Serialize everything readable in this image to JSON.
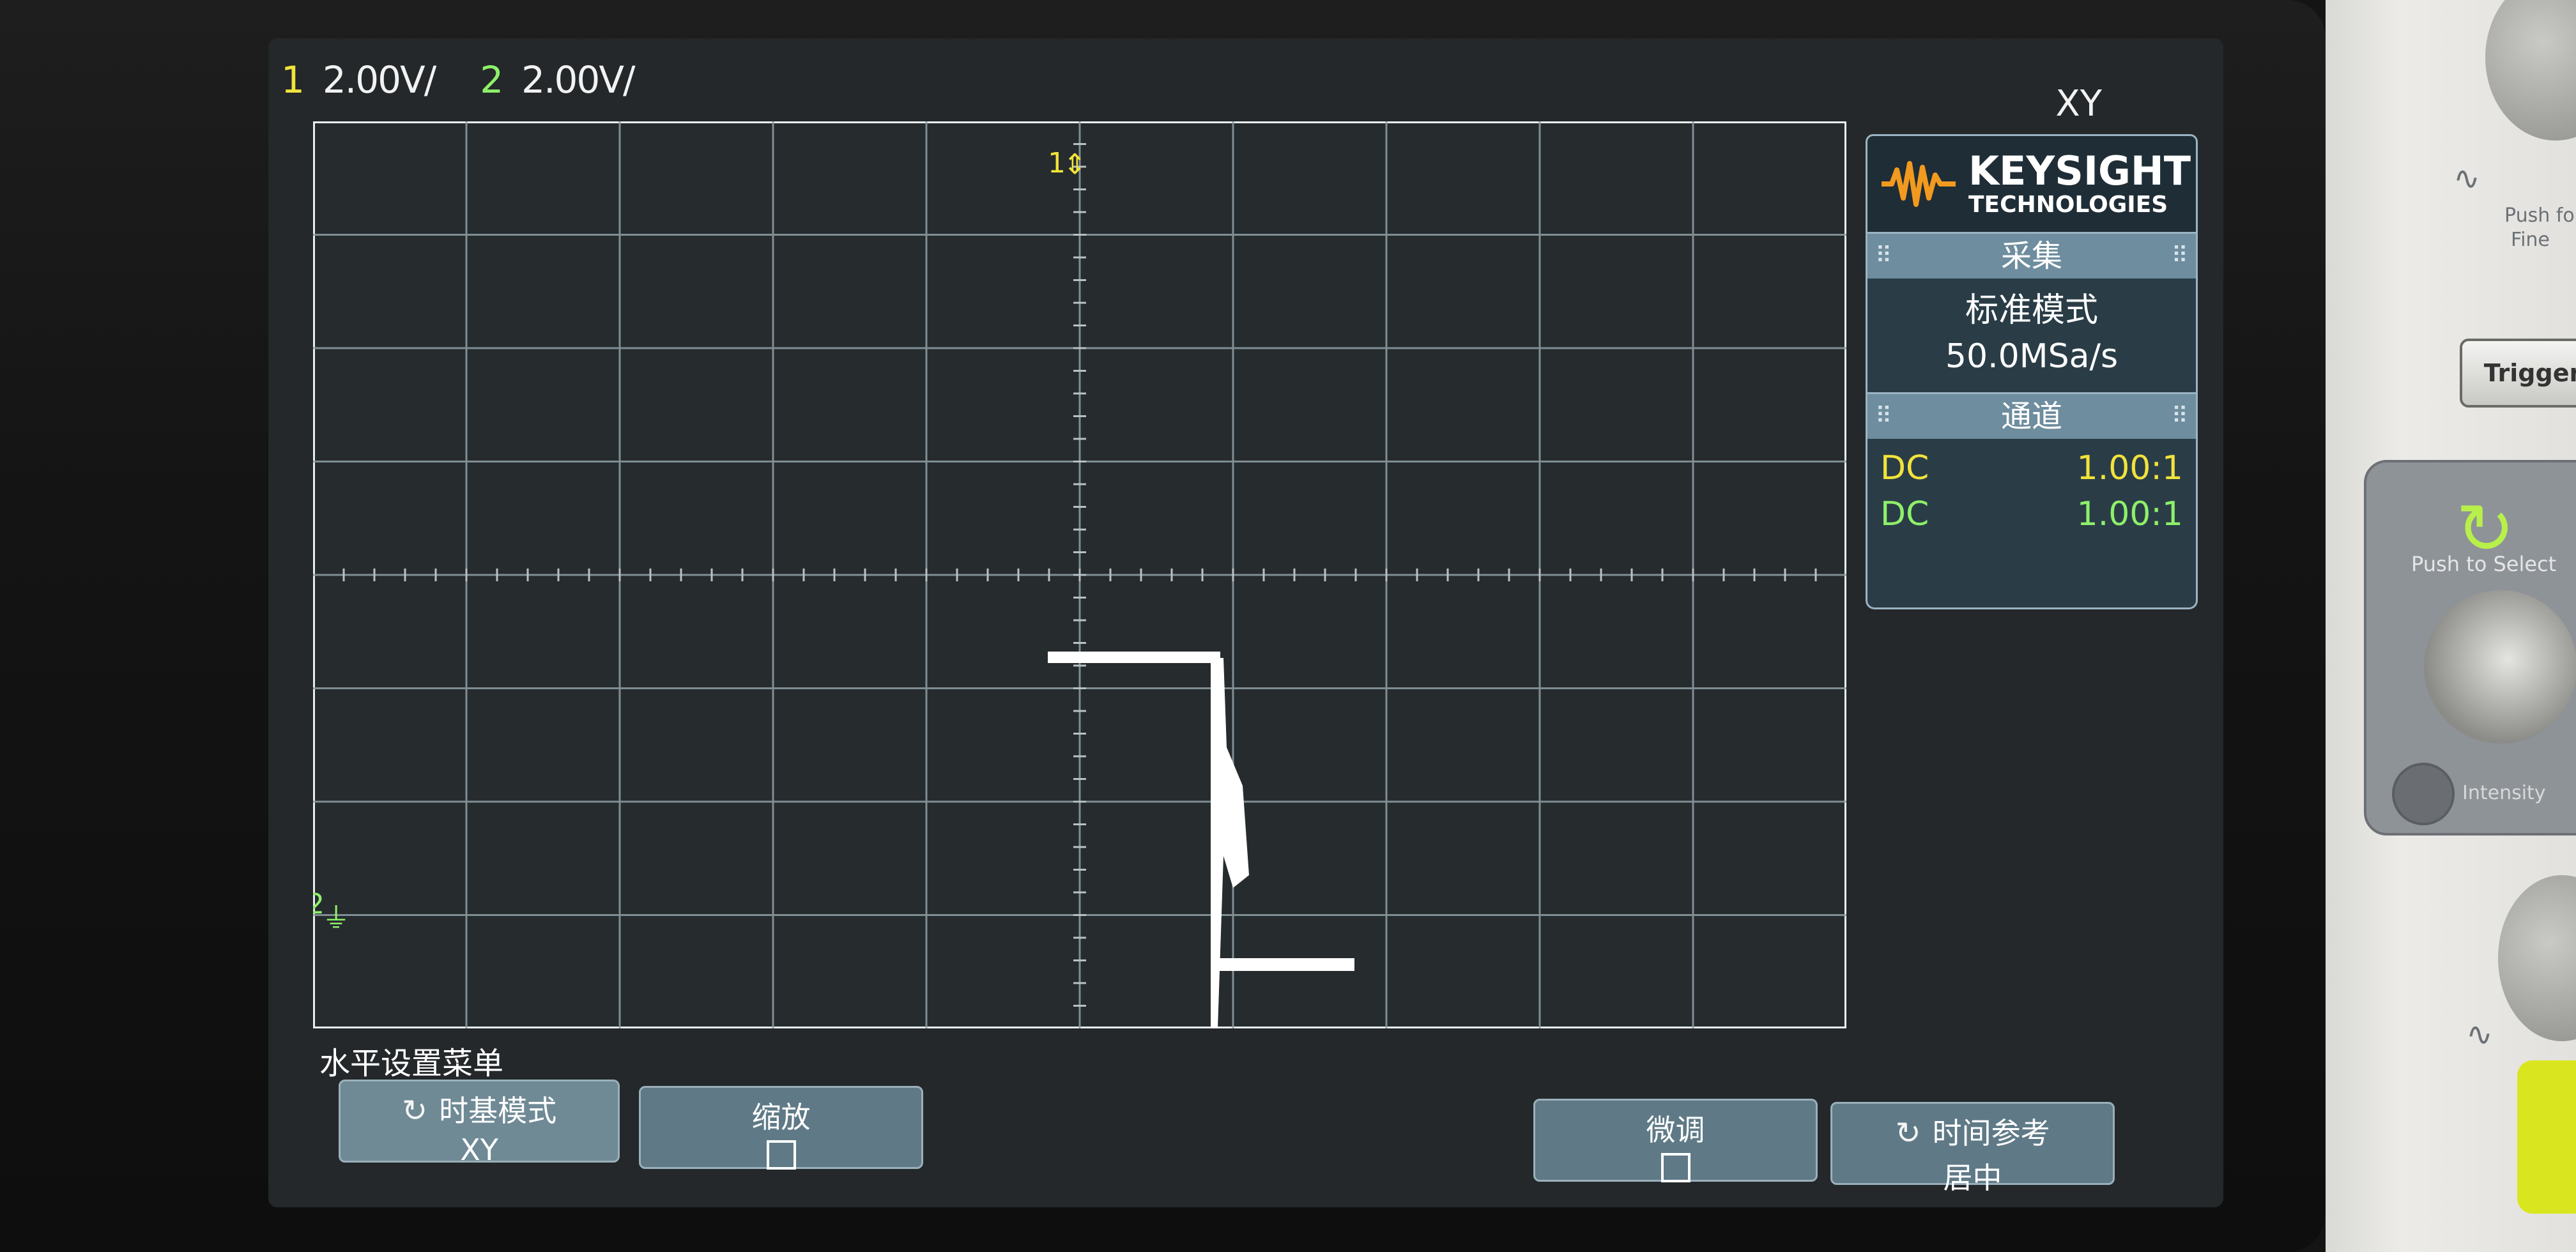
{
  "status_bar": {
    "ch1_num": "1",
    "ch1_scale": "2.00V/",
    "ch2_num": "2",
    "ch2_scale": "2.00V/",
    "ch1_color": "#f1e33b",
    "ch2_color": "#8ef06a"
  },
  "mode": "XY",
  "graticule": {
    "ch1_marker": "1",
    "ch2_marker": "2"
  },
  "side_panel": {
    "logo_line1": "KEYSIGHT",
    "logo_line2": "TECHNOLOGIES",
    "acquire_header": "采集",
    "acquire_mode": "标准模式",
    "sample_rate": "50.0MSa/s",
    "channels_header": "通道",
    "channels": [
      {
        "coupling": "DC",
        "probe": "1.00:1",
        "color": "#f1e33b"
      },
      {
        "coupling": "DC",
        "probe": "1.00:1",
        "color": "#8ef06a"
      }
    ]
  },
  "menu": {
    "title": "水平设置菜单",
    "softkeys": [
      {
        "label": "时基模式",
        "value": "XY"
      },
      {
        "label": "缩放",
        "value": ""
      },
      {
        "label": "微调",
        "value": ""
      },
      {
        "label": "时间参考",
        "value": "居中"
      }
    ]
  },
  "hardware": {
    "push_fine": "Push fo",
    "fine": "Fine",
    "trigger": "Trigger",
    "push_to_select": "Push to Select",
    "intensity": "Intensity"
  }
}
